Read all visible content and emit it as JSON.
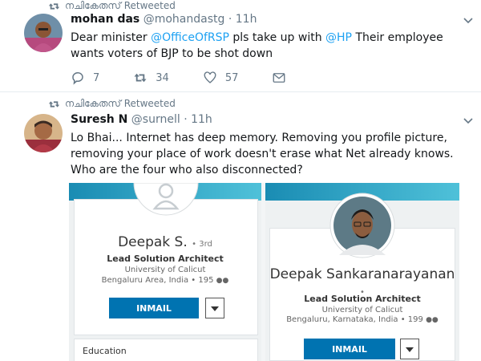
{
  "tweets": [
    {
      "retweeted_by": "നചികേതസ് Retweeted",
      "name": "mohan das",
      "handle": "@mohandastg",
      "separator": "·",
      "time": "11h",
      "text_before": "Dear minister ",
      "mention_1": "@OfficeOfRSP",
      "text_middle": " pls take up with ",
      "mention_2": "@HP",
      "text_after": " Their employee wants voters of BJP to be shot down",
      "replies": "7",
      "retweets": "34",
      "likes": "57"
    },
    {
      "retweeted_by": "നചികേതസ് Retweeted",
      "name": "Suresh N",
      "handle": "@surnell",
      "separator": "·",
      "time": "11h",
      "text": "Lo Bhai... Internet has deep memory. Removing you profile picture, removing your place of work doesn't erase what Net already knows. Who are the four who also disconnected?"
    }
  ],
  "media": {
    "left_profile": {
      "name": "Deepak S.",
      "degree": "• 3rd",
      "title": "Lead Solution Architect",
      "school": "University of Calicut",
      "location": "Bengaluru Area, India • 195",
      "button": "INMAIL",
      "section": "Education"
    },
    "right_profile": {
      "name": "Deepak Sankaranarayanan",
      "name_suffix": "•",
      "title": "Lead Solution Architect",
      "school": "University of Calicut",
      "location": "Bengaluru, Karnataka, India • 199",
      "button": "INMAIL"
    }
  },
  "colors": {
    "link": "#1da1f2",
    "muted": "#657786",
    "inmail": "#0073b1",
    "banner": "#1a8cb3"
  },
  "icons": [
    "retweet-icon",
    "reply-icon",
    "like-icon",
    "message-icon",
    "chevron-down-icon",
    "connections-icon",
    "default-avatar-icon"
  ]
}
